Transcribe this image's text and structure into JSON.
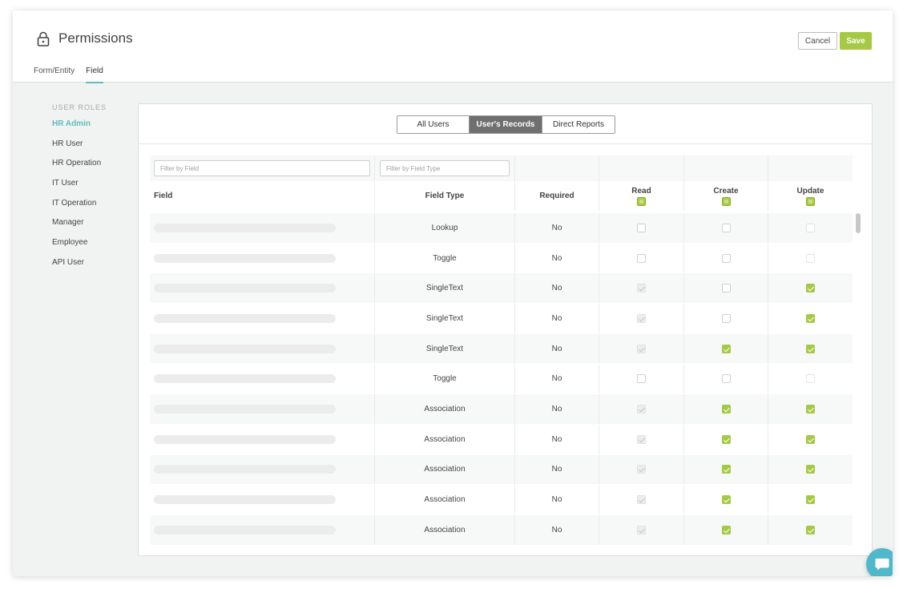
{
  "header": {
    "title": "Permissions",
    "tabs": [
      {
        "label": "Form/Entity",
        "active": false
      },
      {
        "label": "Field",
        "active": true
      }
    ],
    "cancel_label": "Cancel",
    "save_label": "Save"
  },
  "roles": {
    "heading": "USER ROLES",
    "items": [
      "HR Admin",
      "HR User",
      "HR Operation",
      "IT User",
      "IT Operation",
      "Manager",
      "Employee",
      "API User"
    ],
    "active": "HR Admin"
  },
  "scope_tabs": {
    "items": [
      "All Users",
      "User's Records",
      "Direct Reports"
    ],
    "active": "User's Records"
  },
  "filters": {
    "field_placeholder": "Filter by Field",
    "field_type_placeholder": "Filter by Field Type"
  },
  "columns": {
    "field": "Field",
    "field_type": "Field Type",
    "required": "Required",
    "read": "Read",
    "create": "Create",
    "update": "Update"
  },
  "rows": [
    {
      "type": "Lookup",
      "required": "No",
      "read": "unchecked",
      "create": "unchecked",
      "update": "unchecked-light"
    },
    {
      "type": "Toggle",
      "required": "No",
      "read": "unchecked",
      "create": "unchecked",
      "update": "unchecked-light"
    },
    {
      "type": "SingleText",
      "required": "No",
      "read": "disabled",
      "create": "unchecked",
      "update": "checked"
    },
    {
      "type": "SingleText",
      "required": "No",
      "read": "disabled",
      "create": "unchecked",
      "update": "checked"
    },
    {
      "type": "SingleText",
      "required": "No",
      "read": "disabled",
      "create": "checked",
      "update": "checked"
    },
    {
      "type": "Toggle",
      "required": "No",
      "read": "unchecked",
      "create": "unchecked",
      "update": "unchecked-light"
    },
    {
      "type": "Association",
      "required": "No",
      "read": "disabled",
      "create": "checked",
      "update": "checked"
    },
    {
      "type": "Association",
      "required": "No",
      "read": "disabled",
      "create": "checked",
      "update": "checked"
    },
    {
      "type": "Association",
      "required": "No",
      "read": "disabled",
      "create": "checked",
      "update": "checked"
    },
    {
      "type": "Association",
      "required": "No",
      "read": "disabled",
      "create": "checked",
      "update": "checked"
    },
    {
      "type": "Association",
      "required": "No",
      "read": "disabled",
      "create": "checked",
      "update": "checked"
    }
  ],
  "colors": {
    "accent_green": "#a5c944",
    "accent_teal": "#5fbdb9",
    "chat_blue": "#4fb8c9",
    "row_alt": "#f7f8f8"
  }
}
